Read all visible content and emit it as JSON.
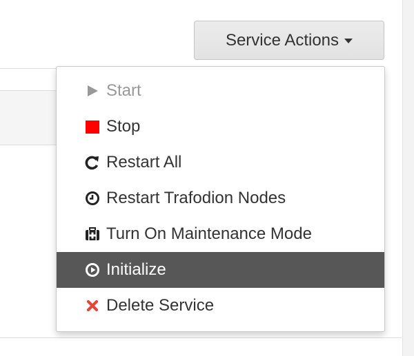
{
  "service_actions": {
    "button_label": "Service Actions",
    "caret_icon": "caret-down-icon",
    "menu_items": [
      {
        "label": "Start",
        "icon": "play-icon",
        "state": "disabled",
        "icon_color": "#999999"
      },
      {
        "label": "Stop",
        "icon": "stop-icon",
        "state": "normal",
        "icon_color": "#ff0000"
      },
      {
        "label": "Restart All",
        "icon": "refresh-icon",
        "state": "normal",
        "icon_color": "#333333"
      },
      {
        "label": "Restart Trafodion Nodes",
        "icon": "clock-icon",
        "state": "normal",
        "icon_color": "#333333"
      },
      {
        "label": "Turn On Maintenance Mode",
        "icon": "medkit-icon",
        "state": "normal",
        "icon_color": "#333333"
      },
      {
        "label": "Initialize",
        "icon": "play-circle-icon",
        "state": "active",
        "icon_color": "#ffffff"
      },
      {
        "label": "Delete Service",
        "icon": "close-icon",
        "state": "normal",
        "icon_color": "#e2463c"
      }
    ]
  },
  "colors": {
    "active_item_bg": "#575757",
    "disabled_text": "#999999",
    "text": "#333333"
  }
}
